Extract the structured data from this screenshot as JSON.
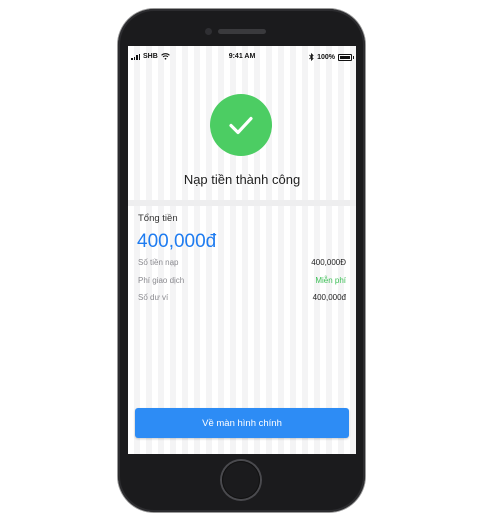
{
  "status_bar": {
    "carrier": "SHB",
    "time": "9:41 AM",
    "battery": "100%"
  },
  "result": {
    "title": "Nạp tiền thành công",
    "total_label": "Tổng tiền",
    "total_amount": "400,000đ"
  },
  "details": [
    {
      "label": "Số tiền nạp",
      "value": "400,000Đ"
    },
    {
      "label": "Phí giao dịch",
      "value": "Miễn phí"
    },
    {
      "label": "Số dư ví",
      "value": "400,000đ"
    }
  ],
  "actions": {
    "home_button_label": "Về màn hình chính"
  },
  "colors": {
    "success": "#4ccd63",
    "accent": "#1f7cf0",
    "button": "#2d8cf5",
    "free_text": "#3cbf56"
  },
  "icons": [
    "signal-icon",
    "wifi-icon",
    "bluetooth-icon",
    "battery-icon",
    "checkmark-icon"
  ]
}
